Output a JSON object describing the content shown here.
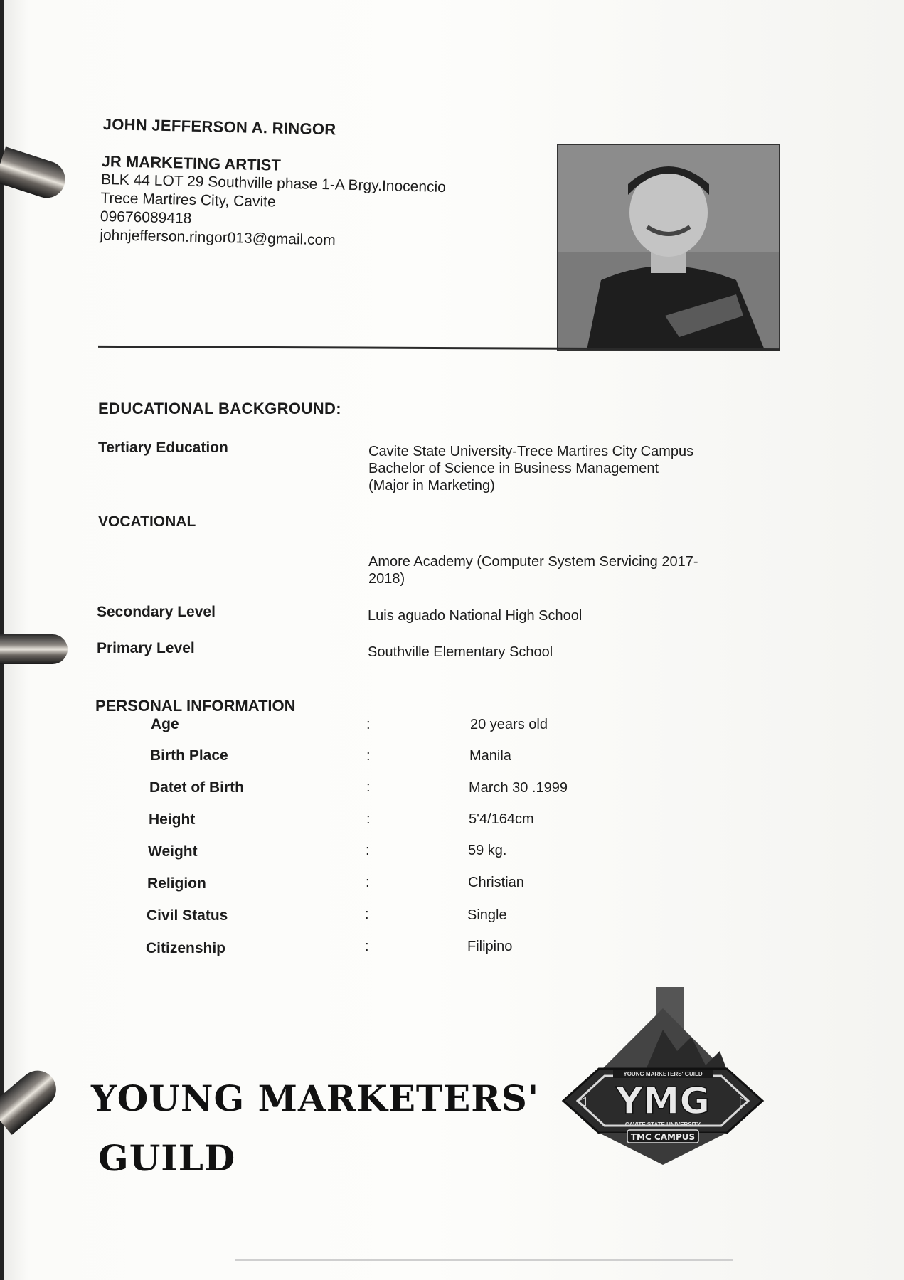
{
  "header": {
    "name": "JOHN JEFFERSON A. RINGOR",
    "position": "JR MARKETING ARTIST",
    "address_line1": "BLK 44 LOT 29 Southville phase 1-A Brgy.Inocencio",
    "address_line2": "Trece Martires City, Cavite",
    "phone": "09676089418",
    "email": "johnjefferson.ringor013@gmail.com"
  },
  "education": {
    "heading": "EDUCATIONAL BACKGROUND:",
    "tertiary_label": "Tertiary Education",
    "tertiary_school": "Cavite State University-Trece Martires City Campus",
    "tertiary_degree": "Bachelor of Science in Business Management",
    "tertiary_major": "(Major in Marketing)",
    "vocational_label": "VOCATIONAL",
    "vocational_line1": "Amore Academy (Computer System Servicing 2017-",
    "vocational_line2": "2018)",
    "secondary_label": "Secondary Level",
    "secondary_school": "Luis aguado National High School",
    "primary_label": "Primary Level",
    "primary_school": "Southville Elementary School"
  },
  "personal": {
    "heading": "PERSONAL INFORMATION",
    "separator": ":",
    "rows": [
      {
        "label": "Age",
        "value": "20 years old"
      },
      {
        "label": "Birth Place",
        "value": "Manila"
      },
      {
        "label": "Datet of Birth",
        "value": "March 30 .1999"
      },
      {
        "label": "Height",
        "value": "5'4/164cm"
      },
      {
        "label": "Weight",
        "value": "59 kg."
      },
      {
        "label": "Religion",
        "value": "Christian"
      },
      {
        "label": "Civil Status",
        "value": "Single"
      },
      {
        "label": "Citizenship",
        "value": "Filipino"
      }
    ]
  },
  "footer": {
    "guild_line1": "YOUNG MARKETERS'",
    "guild_line2": "GUILD",
    "logo_top": "YOUNG MARKETERS' GUILD",
    "logo_main": "YMG",
    "logo_sub1": "CAVITE STATE UNIVERSITY",
    "logo_sub2": "TMC CAMPUS"
  }
}
